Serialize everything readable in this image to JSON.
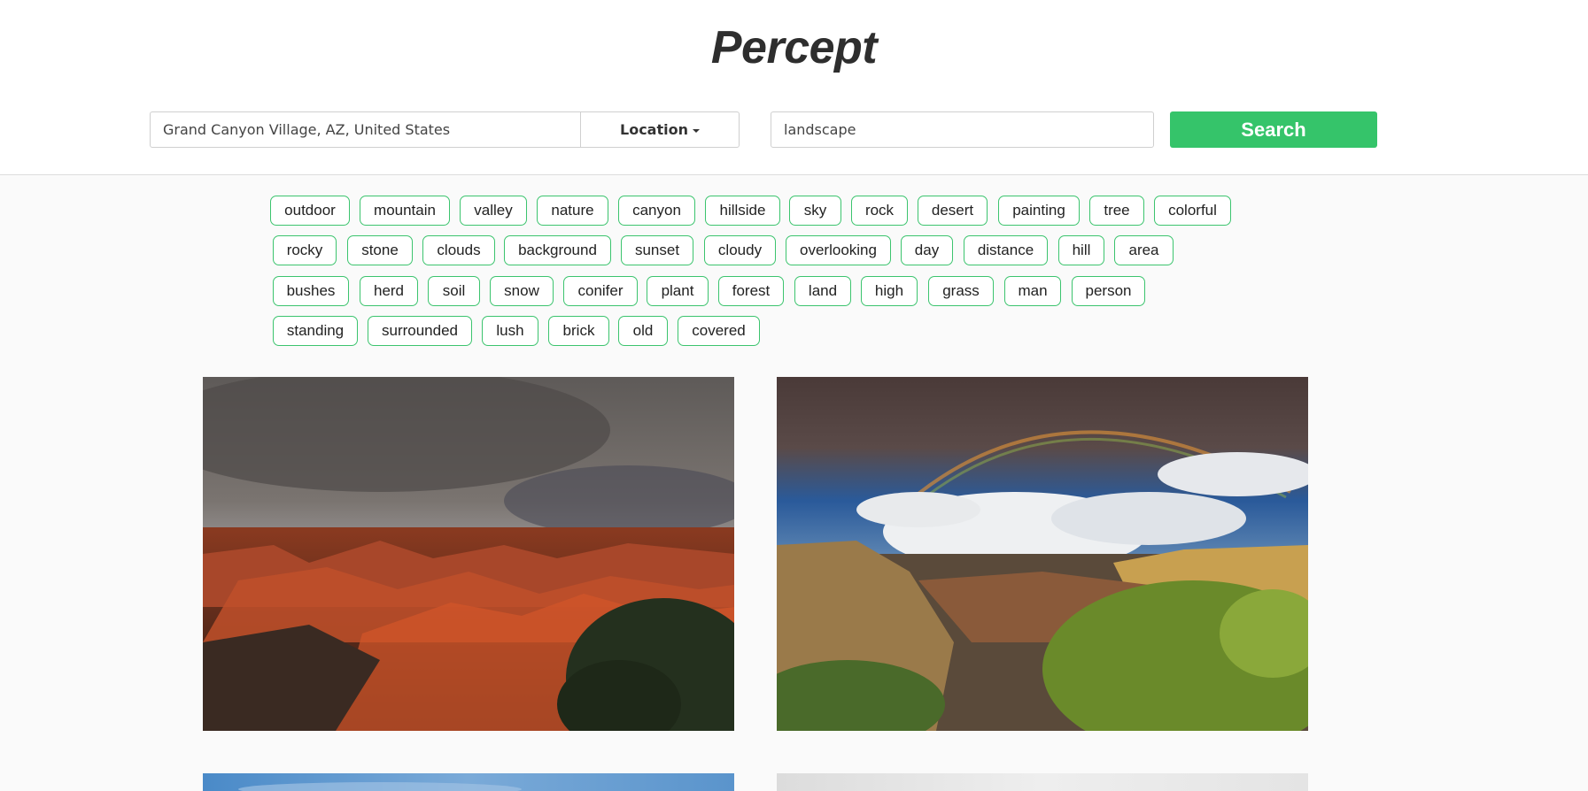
{
  "app": {
    "title": "Percept"
  },
  "search": {
    "location_value": "Grand Canyon Village, AZ, United States",
    "location_button": "Location",
    "keyword_value": "landscape",
    "search_button": "Search"
  },
  "tags": {
    "row1": [
      "outdoor",
      "mountain",
      "valley",
      "nature",
      "canyon",
      "hillside",
      "sky",
      "rock",
      "desert",
      "painting",
      "tree",
      "colorful"
    ],
    "row2": [
      "rocky",
      "stone",
      "clouds",
      "background",
      "sunset",
      "cloudy",
      "overlooking",
      "day",
      "distance",
      "hill",
      "area"
    ],
    "row3": [
      "bushes",
      "herd",
      "soil",
      "snow",
      "conifer",
      "plant",
      "forest",
      "land",
      "high",
      "grass",
      "man",
      "person"
    ],
    "row4": [
      "standing",
      "surrounded",
      "lush",
      "brick",
      "old",
      "covered"
    ]
  },
  "results": {
    "images": [
      {
        "scene": "grand-canyon-storm-photo"
      },
      {
        "scene": "grand-canyon-rainbow-photo"
      },
      {
        "scene": "grand-canyon-blue-photo"
      },
      {
        "scene": "grand-canyon-misty-photo"
      }
    ]
  },
  "colors": {
    "accent": "#35c46a",
    "tag_border": "#3cc46e",
    "brand_text": "#2e2e2e"
  }
}
